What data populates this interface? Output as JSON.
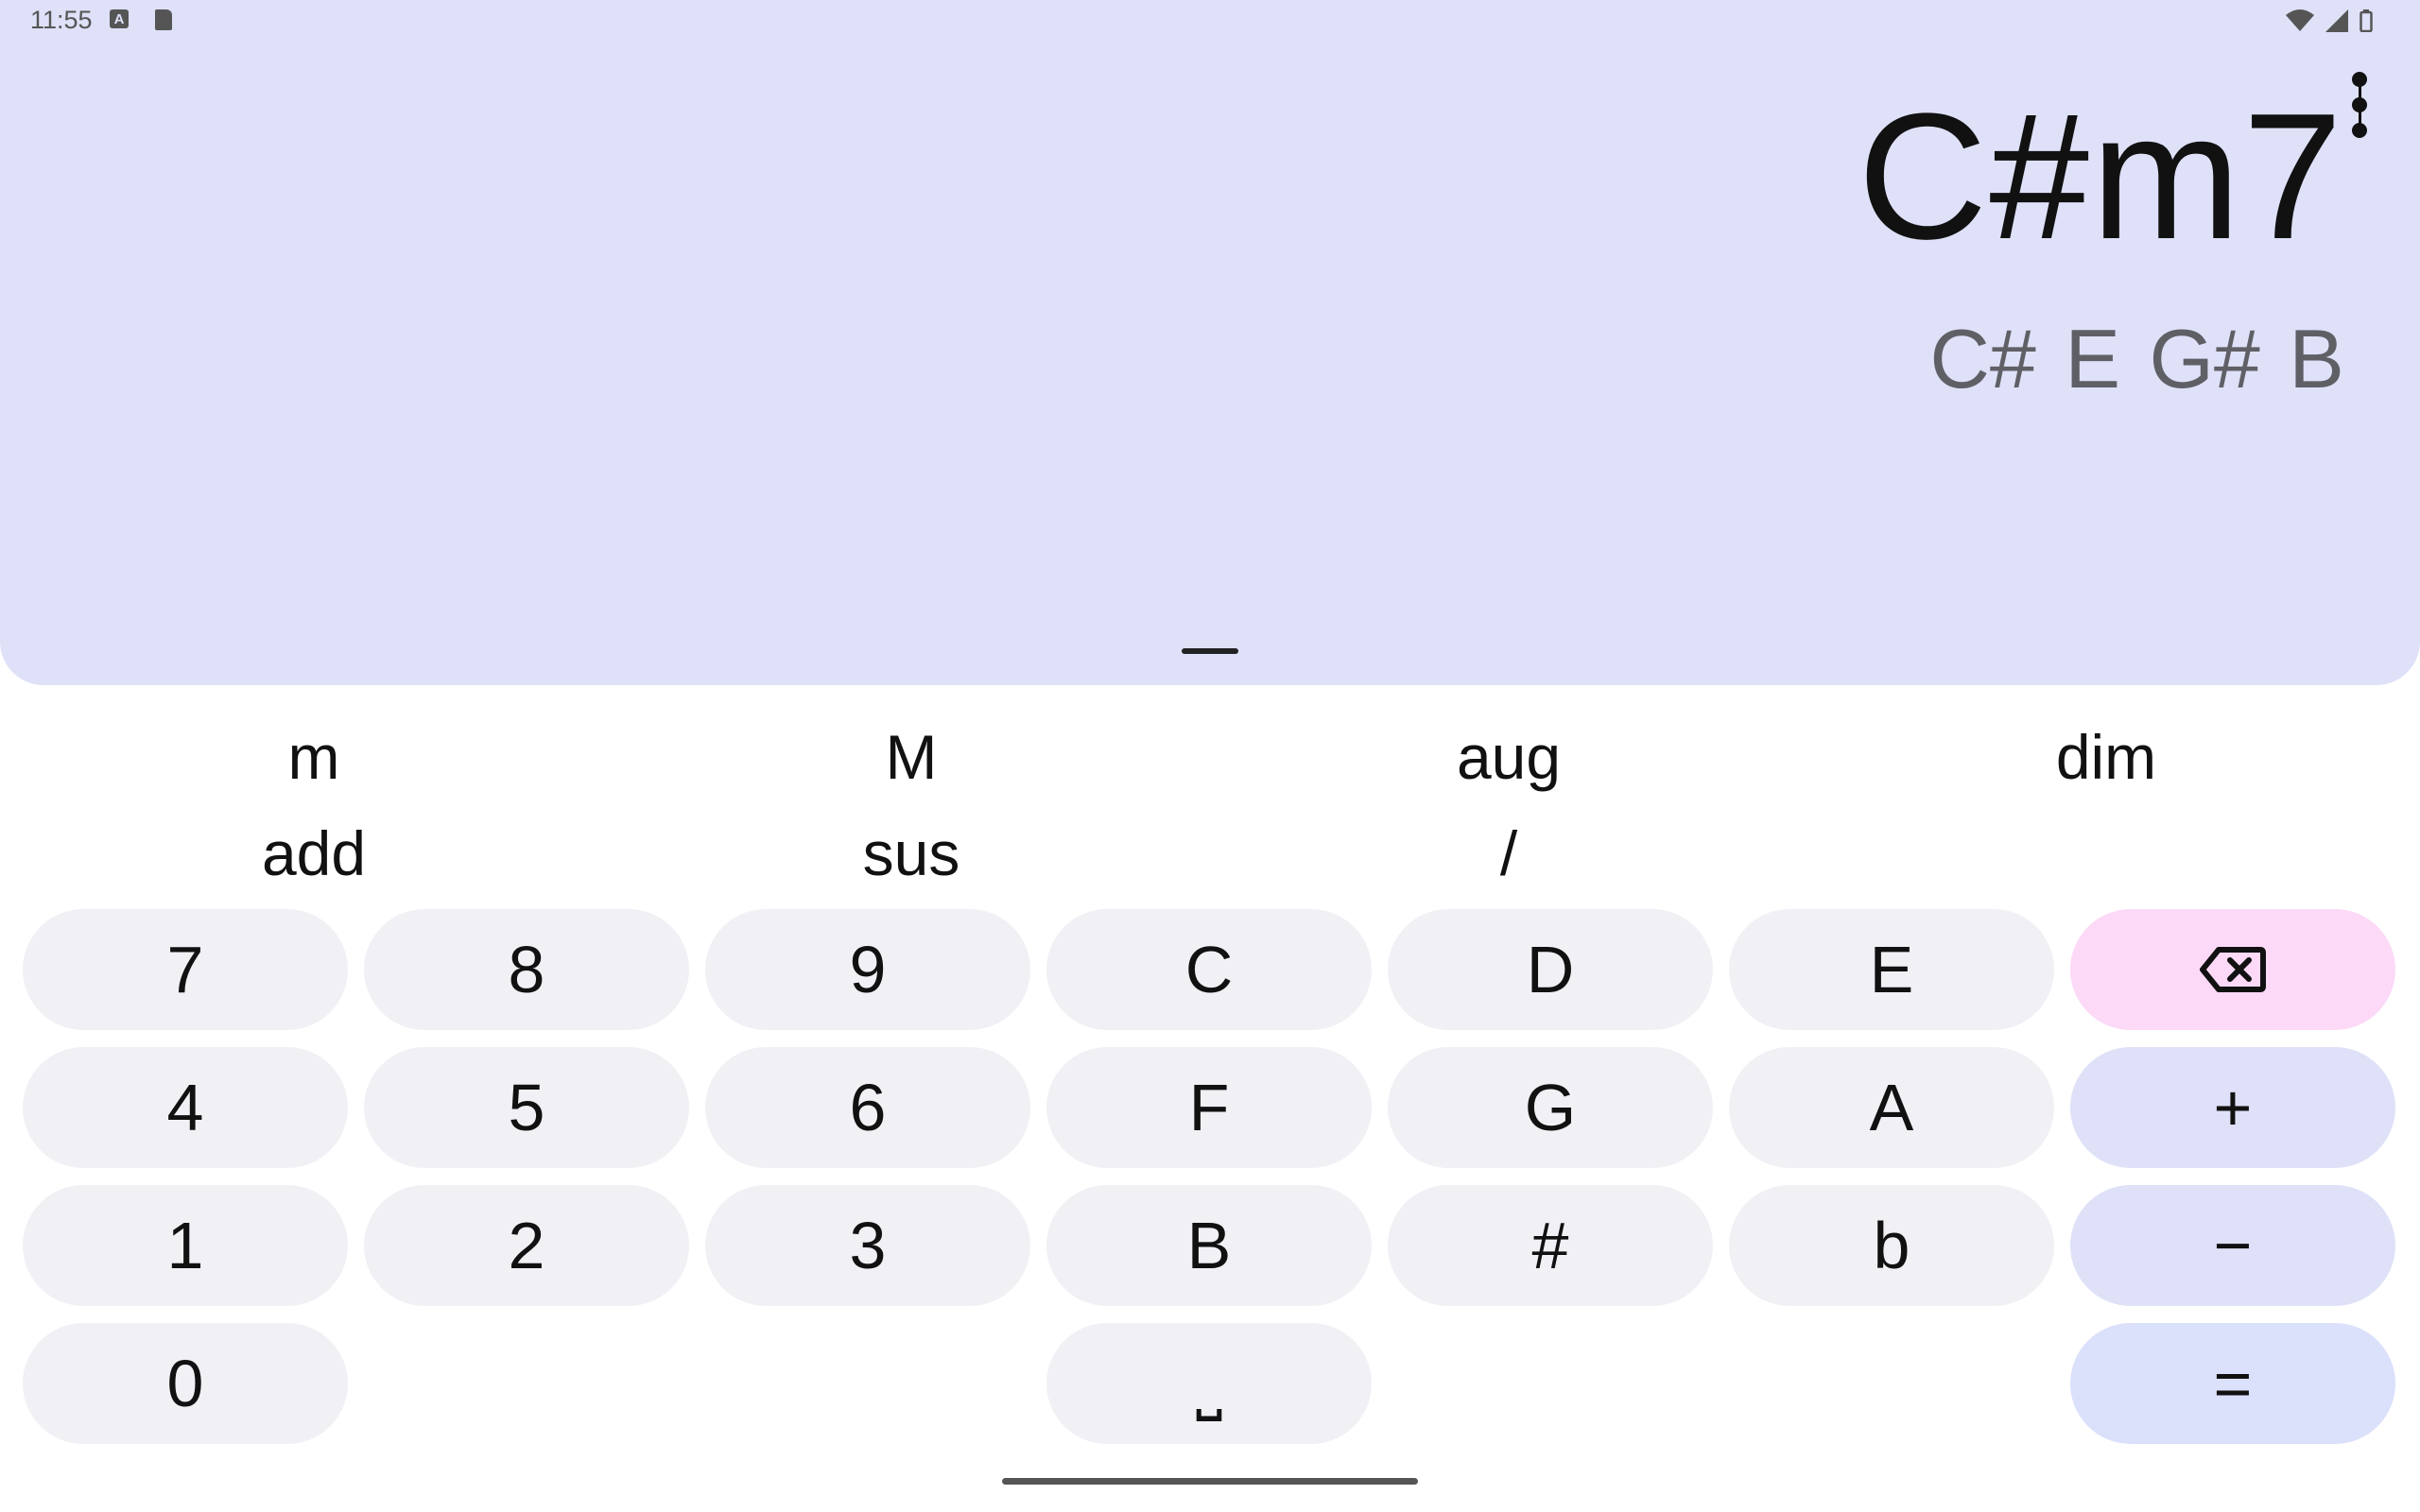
{
  "status_bar": {
    "time": "11:55",
    "a_icon_letter": "A"
  },
  "display": {
    "chord": "C#m7",
    "notes": "C# E G# B"
  },
  "suffixes": {
    "row1": [
      "m",
      "M",
      "aug",
      "dim"
    ],
    "row2": [
      "add",
      "sus",
      "/"
    ]
  },
  "keys": {
    "k7": "7",
    "k8": "8",
    "k9": "9",
    "kC": "C",
    "kD": "D",
    "kE": "E",
    "k4": "4",
    "k5": "5",
    "k6": "6",
    "kF": "F",
    "kG": "G",
    "kA": "A",
    "plus": "+",
    "k1": "1",
    "k2": "2",
    "k3": "3",
    "kB": "B",
    "sharp": "#",
    "flat": "b",
    "minus": "−",
    "k0": "0",
    "space": "⎵",
    "equals": "="
  },
  "colors": {
    "display_bg": "#dee1f8",
    "key_bg": "#f1f0f5",
    "delete_bg": "#fcd9f7",
    "operator_bg": "#dee1f7",
    "equals_bg": "#dbe0fb"
  },
  "icons": [
    "backspace-icon",
    "overflow-menu-icon",
    "wifi-icon",
    "signal-icon",
    "battery-icon",
    "sd-card-icon"
  ]
}
